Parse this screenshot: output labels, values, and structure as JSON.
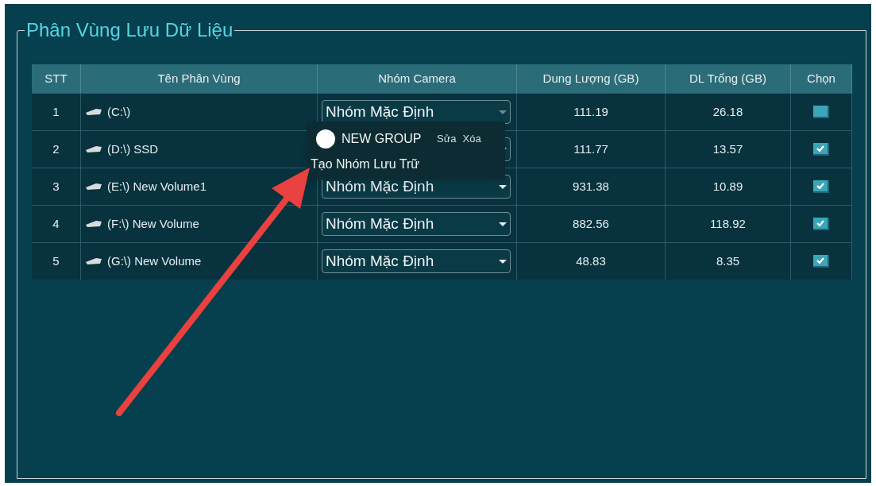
{
  "panel": {
    "title": "Phân Vùng Lưu Dữ Liệu"
  },
  "table": {
    "columns": [
      "STT",
      "Tên Phân Vùng",
      "Nhóm Camera",
      "Dung Lượng (GB)",
      "DL Trống (GB)",
      "Chọn"
    ],
    "rows": [
      {
        "stt": "1",
        "name": "(C:\\)",
        "group": "Nhóm Mặc Định",
        "open": true,
        "size": "111.19",
        "free": "26.18",
        "checked": false
      },
      {
        "stt": "2",
        "name": "(D:\\) SSD",
        "open": false,
        "size": "111.77",
        "free": "13.57",
        "checked": true
      },
      {
        "stt": "3",
        "name": "(E:\\) New Volume1",
        "group": "Nhóm Mặc Định",
        "open": false,
        "size": "931.38",
        "free": "10.89",
        "checked": true
      },
      {
        "stt": "4",
        "name": "(F:\\) New Volume",
        "group": "Nhóm Mặc Định",
        "open": false,
        "size": "882.56",
        "free": "118.92",
        "checked": true
      },
      {
        "stt": "5",
        "name": "(G:\\) New Volume",
        "group": "Nhóm Mặc Định",
        "open": false,
        "size": "48.83",
        "free": "8.35",
        "checked": true
      }
    ]
  },
  "dropdown_menu": {
    "items": [
      {
        "label": "NEW GROUP",
        "actions": [
          "Sửa",
          "Xóa"
        ]
      }
    ],
    "create_label": "Tạo Nhóm Lưu Trữ"
  }
}
